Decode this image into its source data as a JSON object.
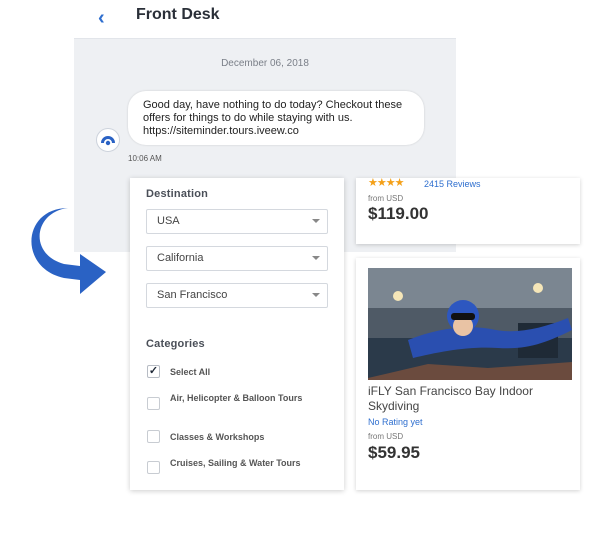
{
  "chat": {
    "title": "Front Desk",
    "date": "December 06, 2018",
    "message": "Good day, have nothing to do today? Checkout these offers for things to do while staying with us. https://siteminder.tours.iveew.co",
    "time": "10:06 AM"
  },
  "filters": {
    "destination_label": "Destination",
    "country": "USA",
    "state": "California",
    "city": "San Francisco",
    "categories_label": "Categories",
    "categories": [
      {
        "label": "Select All",
        "checked": true
      },
      {
        "label": "Air, Helicopter & Balloon Tours",
        "checked": false
      },
      {
        "label": "Classes & Workshops",
        "checked": false
      },
      {
        "label": "Cruises, Sailing & Water Tours",
        "checked": false
      }
    ]
  },
  "listings": [
    {
      "stars": "★★★★",
      "reviews": "2415 Reviews",
      "from": "from USD",
      "price": "$119.00"
    },
    {
      "title": "iFLY San Francisco Bay Indoor Skydiving",
      "rating": "No Rating yet",
      "from": "from USD",
      "price": "$59.95"
    }
  ],
  "colors": {
    "accent": "#2f6fcf",
    "arrow": "#2a62c4",
    "stars": "#f4a018"
  },
  "icons": [
    "back-chevron-icon",
    "avatar-icon",
    "curved-arrow-icon",
    "chevron-down-icon",
    "checkbox-icon"
  ]
}
